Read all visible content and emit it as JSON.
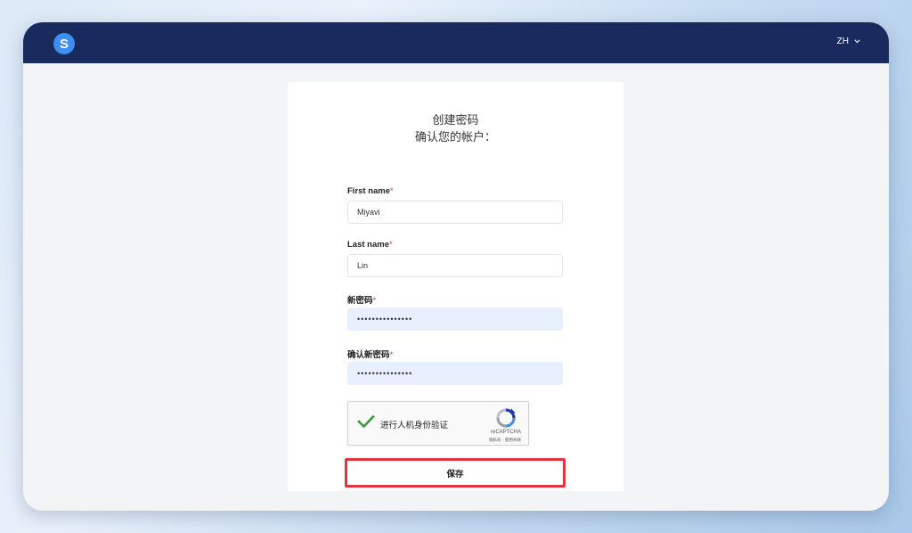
{
  "header": {
    "logo_letter": "S",
    "language": "ZH"
  },
  "form": {
    "title": "创建密码",
    "subtitle": "确认您的帐户：",
    "required_mark": "*",
    "first_name": {
      "label": "First name",
      "value": "Miyavi"
    },
    "last_name": {
      "label": "Last name",
      "value": "Lin"
    },
    "new_password": {
      "label": "新密码",
      "value": "•••••••••••••••"
    },
    "confirm_password": {
      "label": "确认新密码",
      "value": "•••••••••••••••"
    },
    "captcha": {
      "label": "进行人机身份验证",
      "brand": "reCAPTCHA",
      "links": "隐私权 - 使用条款"
    },
    "save_label": "保存"
  },
  "colors": {
    "header_bg": "#182a5e",
    "logo_bg": "#3c8ef0",
    "required": "#d0343c",
    "highlight_border": "#e3343e",
    "autofill_bg": "#e8f0fd",
    "check_green": "#3c9a3a"
  },
  "icons": {
    "logo": "s-logo-icon",
    "language_dropdown": "chevron-down-icon",
    "captcha_check": "checkmark-icon",
    "captcha_logo": "recaptcha-logo-icon"
  }
}
